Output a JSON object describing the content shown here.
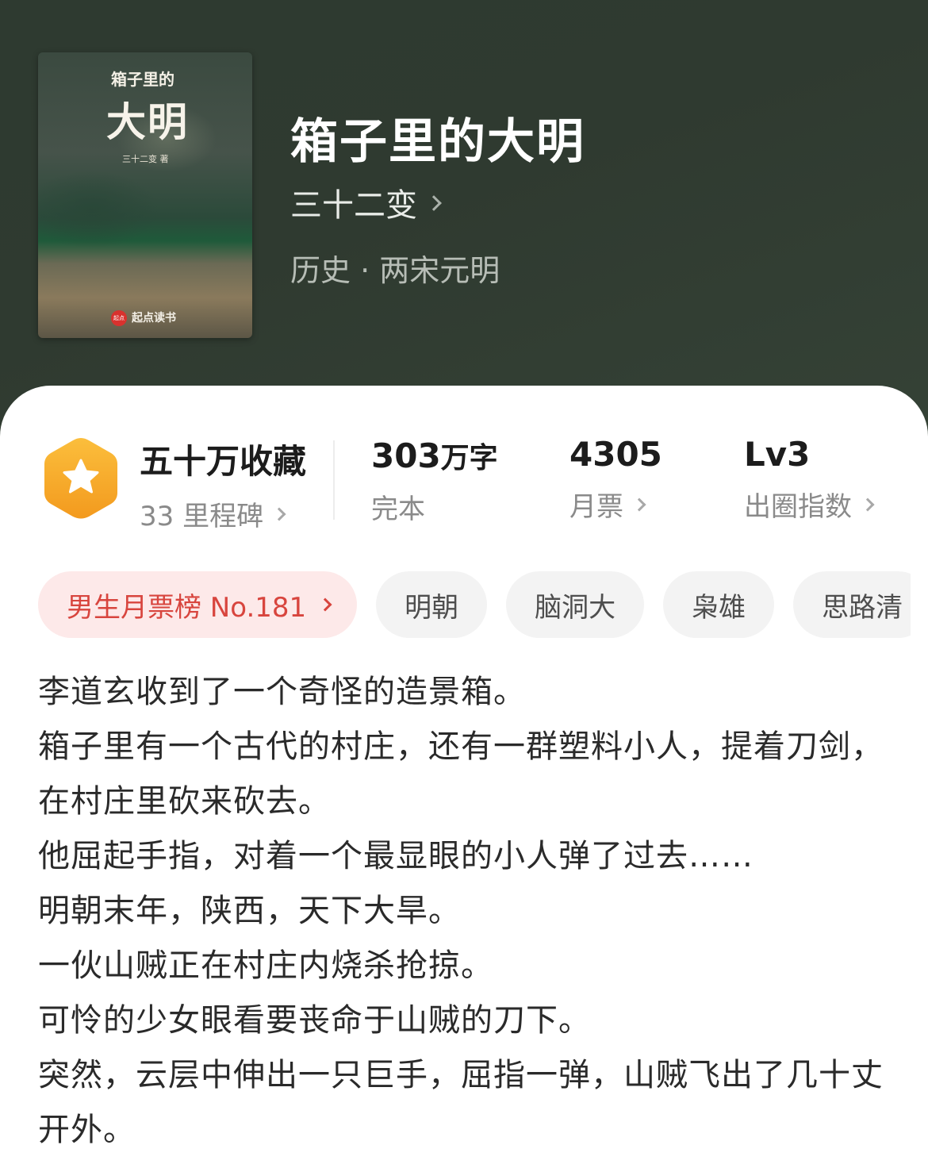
{
  "book": {
    "title": "箱子里的大明",
    "author": "三十二变",
    "genre": "历史 · 两宋元明"
  },
  "cover": {
    "small_title": "箱子里的",
    "big_title": "大明",
    "author_line": "三十二变 著",
    "publisher_mark": "起点",
    "publisher": "起点读书"
  },
  "stats": {
    "collections": "五十万收藏",
    "milestones": "33 里程碑",
    "word_count_number": "303",
    "word_count_unit": "万字",
    "status": "完本",
    "monthly_votes": "4305",
    "monthly_votes_label": "月票",
    "level": "Lv3",
    "level_label": "出圈指数"
  },
  "tags": [
    "男生月票榜 No.181",
    "明朝",
    "脑洞大",
    "枭雄",
    "思路清"
  ],
  "synopsis": [
    "李道玄收到了一个奇怪的造景箱。",
    "箱子里有一个古代的村庄，还有一群塑料小人，提着刀剑，在村庄里砍来砍去。",
    "他屈起手指，对着一个最显眼的小人弹了过去……",
    "明朝末年，陕西，天下大旱。",
    "一伙山贼正在村庄内烧杀抢掠。",
    "可怜的少女眼看要丧命于山贼的刀下。",
    "突然，云层中伸出一只巨手，屈指一弹，山贼飞出了几十丈开外。"
  ],
  "colors": {
    "header_bg": "#2f3a30",
    "rank_tag_bg": "#fde9e9",
    "rank_tag_text": "#d8453e",
    "badge_orange": "#f7a928"
  },
  "icons": {
    "badge": "star-hexagon-icon",
    "chevron": "chevron-right-icon"
  }
}
